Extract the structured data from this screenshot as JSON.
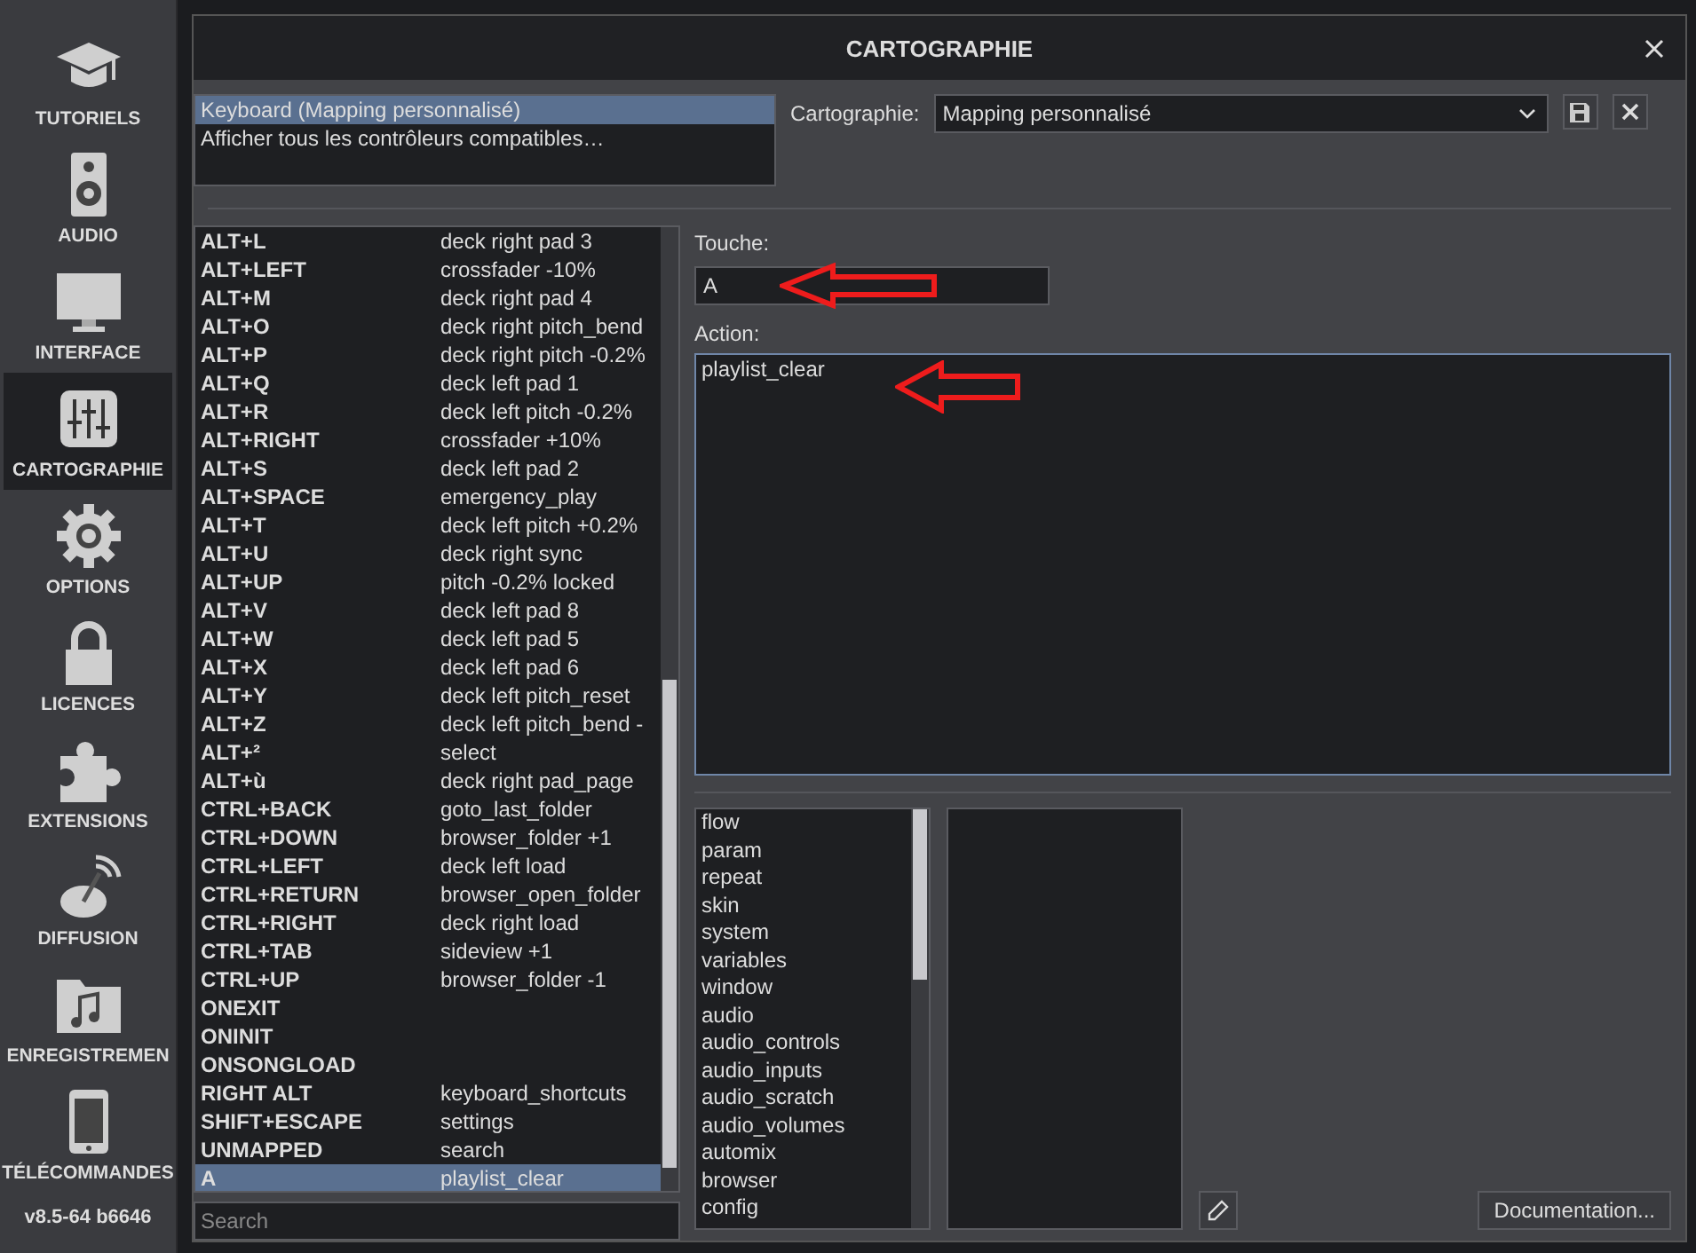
{
  "sidebar": {
    "items": [
      {
        "label": "TUTORIELS",
        "selected": false
      },
      {
        "label": "AUDIO",
        "selected": false
      },
      {
        "label": "INTERFACE",
        "selected": false
      },
      {
        "label": "CARTOGRAPHIE",
        "selected": true
      },
      {
        "label": "OPTIONS",
        "selected": false
      },
      {
        "label": "LICENCES",
        "selected": false
      },
      {
        "label": "EXTENSIONS",
        "selected": false
      },
      {
        "label": "DIFFUSION",
        "selected": false
      },
      {
        "label": "ENREGISTREMEN",
        "selected": false
      },
      {
        "label": "TÉLÉCOMMANDES",
        "selected": false
      }
    ],
    "version": "v8.5-64 b6646"
  },
  "window": {
    "title": "CARTOGRAPHIE"
  },
  "devices": [
    {
      "label": "Keyboard (Mapping personnalisé)",
      "selected": true
    },
    {
      "label": "Afficher tous les contrôleurs compatibles…",
      "selected": false
    }
  ],
  "mapping": {
    "label": "Cartographie:",
    "value": "Mapping personnalisé"
  },
  "keys": [
    {
      "key": "ALT+L",
      "action": "deck right pad 3",
      "selected": false
    },
    {
      "key": "ALT+LEFT",
      "action": "crossfader -10%",
      "selected": false
    },
    {
      "key": "ALT+M",
      "action": "deck right pad 4",
      "selected": false
    },
    {
      "key": "ALT+O",
      "action": "deck right pitch_bend",
      "selected": false
    },
    {
      "key": "ALT+P",
      "action": "deck right pitch -0.2%",
      "selected": false
    },
    {
      "key": "ALT+Q",
      "action": "deck left pad 1",
      "selected": false
    },
    {
      "key": "ALT+R",
      "action": "deck left pitch -0.2%",
      "selected": false
    },
    {
      "key": "ALT+RIGHT",
      "action": "crossfader +10%",
      "selected": false
    },
    {
      "key": "ALT+S",
      "action": "deck left pad 2",
      "selected": false
    },
    {
      "key": "ALT+SPACE",
      "action": "emergency_play",
      "selected": false
    },
    {
      "key": "ALT+T",
      "action": "deck left pitch +0.2%",
      "selected": false
    },
    {
      "key": "ALT+U",
      "action": "deck right sync",
      "selected": false
    },
    {
      "key": "ALT+UP",
      "action": "pitch -0.2% locked",
      "selected": false
    },
    {
      "key": "ALT+V",
      "action": "deck left pad 8",
      "selected": false
    },
    {
      "key": "ALT+W",
      "action": "deck left pad 5",
      "selected": false
    },
    {
      "key": "ALT+X",
      "action": "deck left pad 6",
      "selected": false
    },
    {
      "key": "ALT+Y",
      "action": "deck left pitch_reset",
      "selected": false
    },
    {
      "key": "ALT+Z",
      "action": "deck left pitch_bend -",
      "selected": false
    },
    {
      "key": "ALT+²",
      "action": "select",
      "selected": false
    },
    {
      "key": "ALT+ù",
      "action": "deck right pad_page",
      "selected": false
    },
    {
      "key": "CTRL+BACK",
      "action": "goto_last_folder",
      "selected": false
    },
    {
      "key": "CTRL+DOWN",
      "action": "browser_folder +1",
      "selected": false
    },
    {
      "key": "CTRL+LEFT",
      "action": "deck left load",
      "selected": false
    },
    {
      "key": "CTRL+RETURN",
      "action": "browser_open_folder",
      "selected": false
    },
    {
      "key": "CTRL+RIGHT",
      "action": "deck right load",
      "selected": false
    },
    {
      "key": "CTRL+TAB",
      "action": "sideview +1",
      "selected": false
    },
    {
      "key": "CTRL+UP",
      "action": "browser_folder -1",
      "selected": false
    },
    {
      "key": "ONEXIT",
      "selected": false
    },
    {
      "key": "ONINIT",
      "selected": false
    },
    {
      "key": "ONSONGLOAD",
      "selected": false
    },
    {
      "key": "RIGHT ALT",
      "action": "keyboard_shortcuts",
      "selected": false
    },
    {
      "key": "SHIFT+ESCAPE",
      "action": "settings",
      "selected": false
    },
    {
      "key": "UNMAPPED",
      "action": "search",
      "selected": false
    },
    {
      "key": "A",
      "action": "playlist_clear",
      "selected": true
    }
  ],
  "search": {
    "placeholder": "Search"
  },
  "key_field": {
    "label": "Touche:",
    "value": "A"
  },
  "action_field": {
    "label": "Action:",
    "value": "playlist_clear"
  },
  "categories": [
    "flow",
    "param",
    "repeat",
    "skin",
    "system",
    "variables",
    "window",
    "audio",
    "audio_controls",
    "audio_inputs",
    "audio_scratch",
    "audio_volumes",
    "automix",
    "browser",
    "config"
  ],
  "documentation_button": "Documentation..."
}
